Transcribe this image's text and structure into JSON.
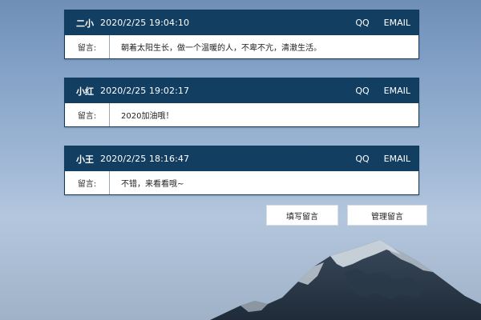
{
  "messages": [
    {
      "author": "二小",
      "time": "2020/2/25 19:04:10",
      "qq": "QQ",
      "email": "EMAIL",
      "label": "留言:",
      "content": "朝着太阳生长，做一个温暖的人，不卑不亢，清澈生活。"
    },
    {
      "author": "小红",
      "time": "2020/2/25 19:02:17",
      "qq": "QQ",
      "email": "EMAIL",
      "label": "留言:",
      "content": "2020加油哦！"
    },
    {
      "author": "小王",
      "time": "2020/2/25 18:16:47",
      "qq": "QQ",
      "email": "EMAIL",
      "label": "留言:",
      "content": "不错，来看看哦~"
    }
  ],
  "actions": {
    "write_label": "填写留言",
    "manage_label": "管理留言"
  },
  "colors": {
    "header_bg": "#123e62",
    "sky_top": "#6f8fb8",
    "sky_bottom": "#b3c6dd"
  }
}
